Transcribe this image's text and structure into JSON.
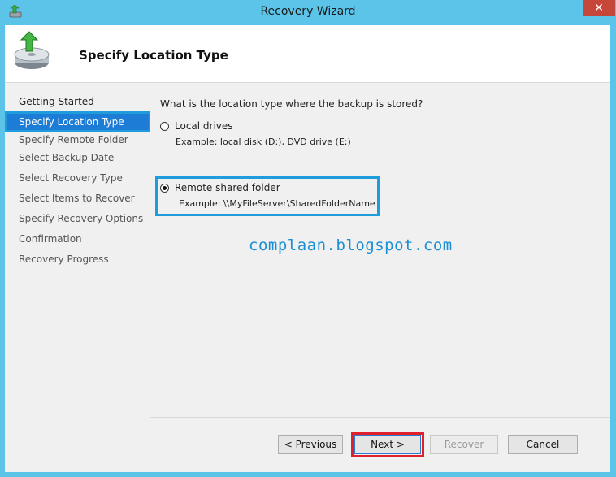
{
  "window": {
    "title": "Recovery Wizard",
    "close_label": "✕"
  },
  "header": {
    "title": "Specify Location Type"
  },
  "steps": [
    {
      "label": "Getting Started",
      "state": "done"
    },
    {
      "label": "Specify Location Type",
      "state": "active"
    },
    {
      "label": "Specify Remote Folder",
      "state": "pending"
    },
    {
      "label": "Select Backup Date",
      "state": "pending"
    },
    {
      "label": "Select Recovery Type",
      "state": "pending"
    },
    {
      "label": "Select Items to Recover",
      "state": "pending"
    },
    {
      "label": "Specify Recovery Options",
      "state": "pending"
    },
    {
      "label": "Confirmation",
      "state": "pending"
    },
    {
      "label": "Recovery Progress",
      "state": "pending"
    }
  ],
  "content": {
    "question": "What is the location type where the backup is stored?",
    "options": [
      {
        "label": "Local drives",
        "example": "Example: local disk (D:), DVD drive (E:)",
        "checked": false
      },
      {
        "label": "Remote shared folder",
        "example": "Example: \\\\MyFileServer\\SharedFolderName",
        "checked": true
      }
    ],
    "watermark": "complaan.blogspot.com"
  },
  "buttons": {
    "previous": "< Previous",
    "next": "Next >",
    "recover": "Recover",
    "cancel": "Cancel"
  },
  "colors": {
    "frame": "#5bc4e8",
    "active_step": "#1c7cd6",
    "highlight_blue": "#1e9cdc",
    "highlight_red": "#e0202a"
  },
  "icons": {
    "title": "backup-restore-icon",
    "header": "disk-restore-icon"
  }
}
